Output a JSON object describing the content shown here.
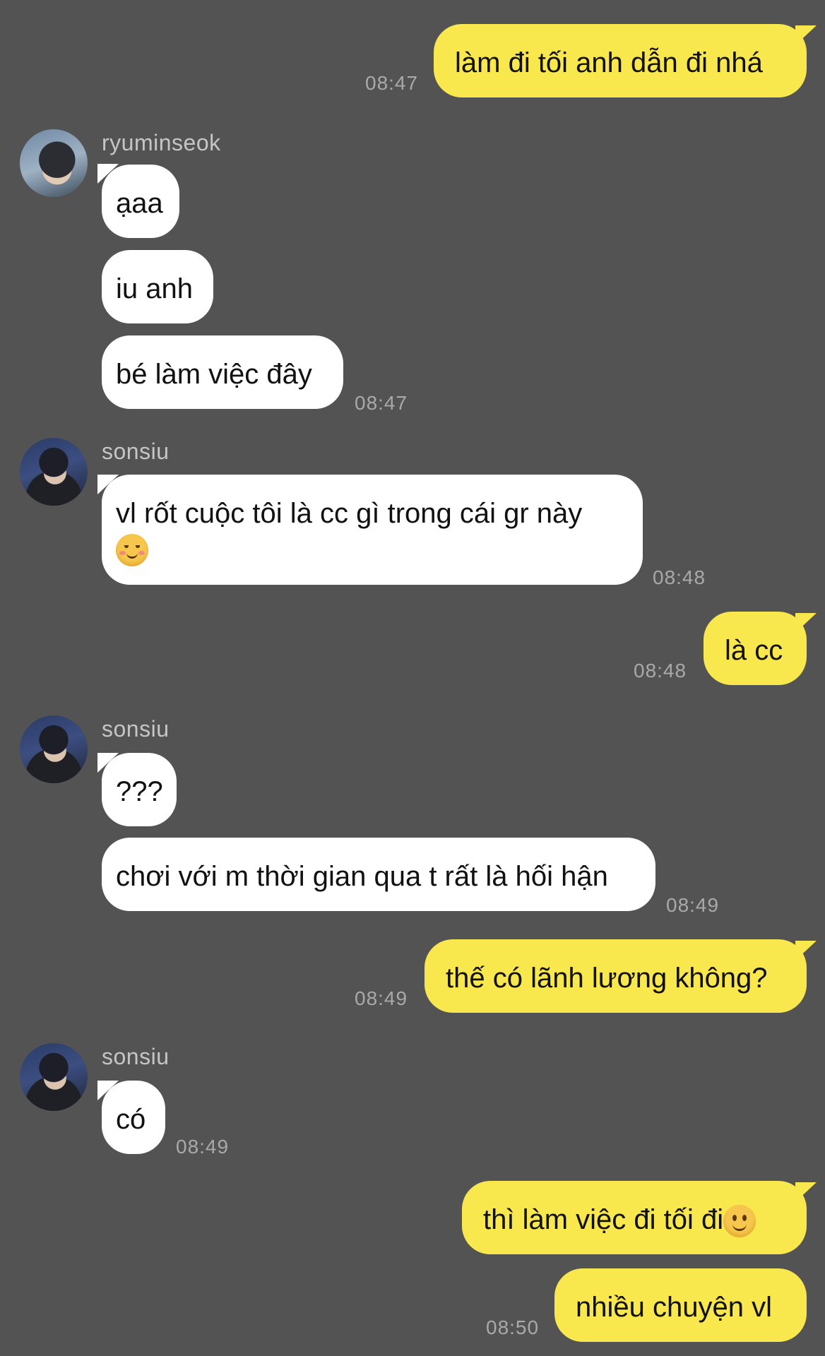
{
  "messages": {
    "m1": {
      "text": "làm đi tối anh dẫn đi nhá",
      "time": "08:47"
    },
    "g1": {
      "sender": "ryuminseok",
      "bubbles": [
        "ạaa",
        "iu anh",
        "bé làm việc đây"
      ],
      "time": "08:47"
    },
    "g2": {
      "sender": "sonsiu",
      "text": "vl rốt cuộc tôi là cc gì trong cái gr này",
      "emoji": "relieved-face",
      "time": "08:48"
    },
    "m2": {
      "text": "là cc",
      "time": "08:48"
    },
    "g3": {
      "sender": "sonsiu",
      "bubbles": [
        "???",
        "chơi với m thời gian qua t rất là hối hận"
      ],
      "time": "08:49"
    },
    "m3": {
      "text": "thế có lãnh lương không?",
      "time": "08:49"
    },
    "g4": {
      "sender": "sonsiu",
      "text": "có",
      "time": "08:49"
    },
    "m4": {
      "text": "thì làm việc đi tối đi",
      "emoji": "slightly-smiling-face"
    },
    "m5": {
      "text": "nhiều chuyện vl",
      "time": "08:50"
    }
  },
  "colors": {
    "background": "#545354",
    "outgoing_bubble": "#f8e74d",
    "incoming_bubble": "#ffffff",
    "timestamp": "#a9a9a9"
  }
}
